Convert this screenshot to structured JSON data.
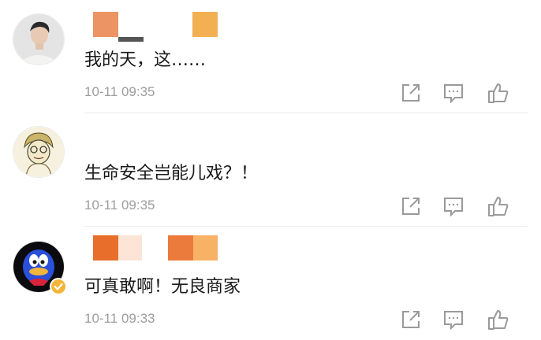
{
  "comments": [
    {
      "text": "我的天，这……",
      "time": "10-11 09:35",
      "avatar": "avatar-man-white-sweater",
      "username_colors": [
        "#ec9464",
        "#f2b053"
      ]
    },
    {
      "text": "生命安全岂能儿戏？！",
      "time": "10-11 09:35",
      "avatar": "avatar-cartoon-sketch",
      "username_colors": []
    },
    {
      "text": "可真敢啊！无良商家",
      "time": "10-11 09:33",
      "avatar": "avatar-blue-duck",
      "username_colors": [
        "#e86f2b",
        "#fce4d6",
        "#eb7b3d",
        "#f7b266"
      ],
      "verified": true
    }
  ],
  "actions": [
    "share-icon",
    "comment-icon",
    "like-icon"
  ],
  "colors": {
    "text": "#1a1a1a",
    "meta": "#9d9d9d",
    "icon": "#9a9a9a",
    "verified": "#f3b53a"
  }
}
